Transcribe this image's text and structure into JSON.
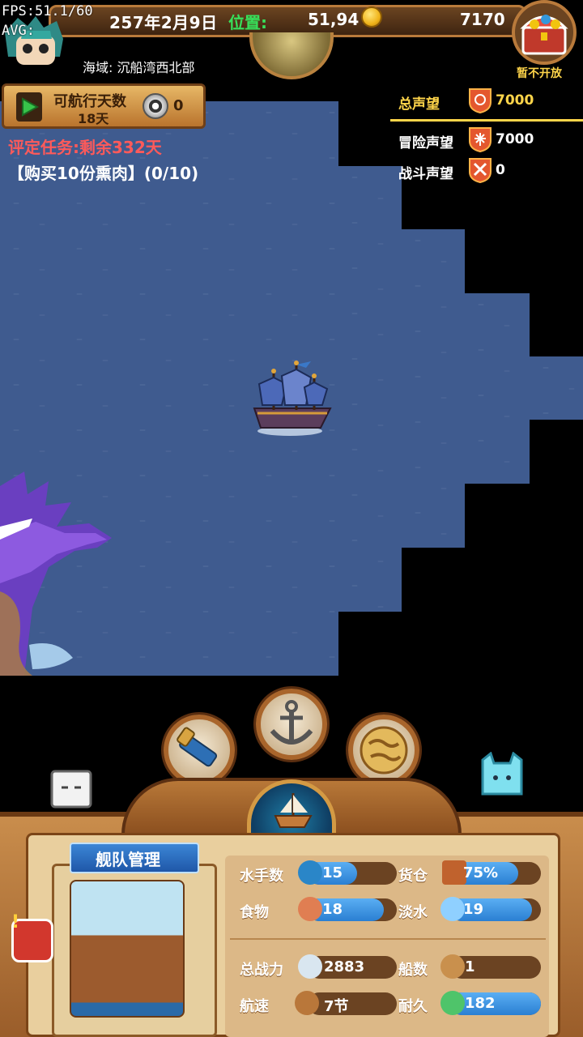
{
  "debug": {
    "fps": "FPS:51.1/60",
    "avg": "AVG:"
  },
  "topbar": {
    "date": "257年2月9日",
    "position_label": "位置:",
    "position_value": "51,94",
    "gold": "7170",
    "chest_label": "暂不开放"
  },
  "region": "海域:  沉船湾西北部",
  "voyage": {
    "label": "可航行天数",
    "days": "18天",
    "token_count": "0"
  },
  "task": {
    "title": "评定任务:剩余332天",
    "item": "【购买10份熏肉】(0/10)"
  },
  "reputation": {
    "total_label": "总声望",
    "total_value": "7000",
    "adventure_label": "冒险声望",
    "adventure_value": "7000",
    "battle_label": "战斗声望",
    "battle_value": "0"
  },
  "fleet": {
    "title": "舰队管理",
    "sailors_label": "水手数",
    "sailors_value": "15",
    "sailors_fill": 0.55,
    "cargo_label": "货仓",
    "cargo_value": "75%",
    "cargo_fill": 0.75,
    "food_label": "食物",
    "food_value": "18",
    "food_fill": 0.85,
    "water_label": "淡水",
    "water_value": "19",
    "water_fill": 0.9,
    "power_label": "总战力",
    "power_value": "2883",
    "ships_label": "船数",
    "ships_value": "1",
    "speed_label": "航速",
    "speed_value": "7节",
    "durability_label": "耐久",
    "durability_value": "182",
    "durability_fill": 1.0
  },
  "colors": {
    "sea": "#3f5b8f",
    "accent_green": "#37e05a",
    "reputation_yellow": "#ffd54a",
    "task_red": "#ff5a5a"
  },
  "icons": [
    "play-icon",
    "coin-icon",
    "token-icon",
    "shield-icon",
    "spyglass-icon",
    "anchor-icon",
    "map-icon",
    "ship-icon",
    "treasure-chest-icon"
  ]
}
